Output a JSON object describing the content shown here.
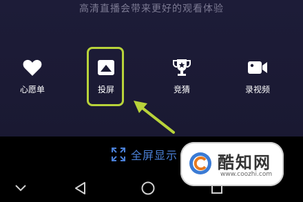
{
  "hint_text": "高清直播会带来更好的观看体验",
  "actions": [
    {
      "label": "心愿单",
      "icon": "heart-icon"
    },
    {
      "label": "投屏",
      "icon": "cast-screen-icon"
    },
    {
      "label": "竞猜",
      "icon": "trophy-icon"
    },
    {
      "label": "录视频",
      "icon": "video-camera-icon"
    }
  ],
  "fullscreen_label": "全屏显示",
  "nav": [
    "chevron-down-icon",
    "back-triangle-icon",
    "home-circle-icon",
    "recent-square-icon"
  ],
  "watermark": {
    "name": "酷知网",
    "url": "www.coozhi.com"
  },
  "colors": {
    "panel_bg": "#1b1a33",
    "highlight": "#b8d33a",
    "arrow": "#b8d33a",
    "fullscreen_text": "#4a7fd6",
    "navbar_bg": "#000000"
  }
}
